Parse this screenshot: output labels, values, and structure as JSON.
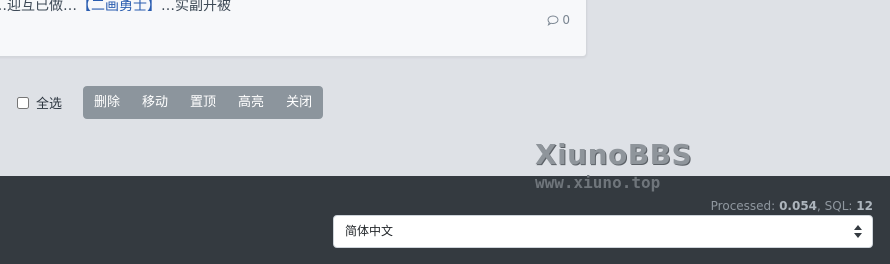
{
  "thread": {
    "title_prefix": "…迎互已做…",
    "title_highlight": "【二画勇士】",
    "title_suffix": "…实副开被",
    "comments_count": "0",
    "comment_icon": "speech-bubble-icon"
  },
  "moderation": {
    "select_all_label": "全选",
    "buttons": [
      "删除",
      "移动",
      "置顶",
      "高亮",
      "关闭"
    ]
  },
  "watermark": {
    "main": "XiunoBBS",
    "sub": "www.xiuno.top"
  },
  "footer": {
    "stats": {
      "processed_label": "Processed:",
      "processed_value": "0.054",
      "sql_label": "SQL:",
      "sql_value": "12"
    },
    "language": {
      "selected": "简体中文"
    }
  },
  "colors": {
    "page_bg": "#dee1e6",
    "footer_bg": "#343a40",
    "button_group_bg": "#8c959d"
  }
}
